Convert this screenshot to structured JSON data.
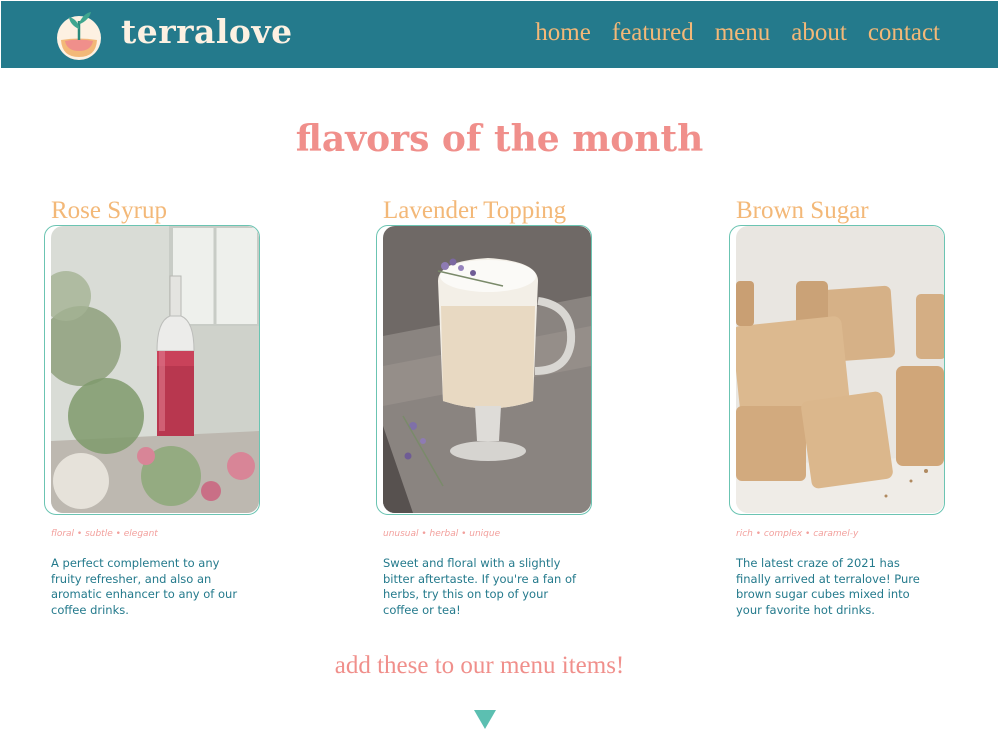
{
  "brand": {
    "name": "terralove",
    "logo_icon": "plant-bowl-icon"
  },
  "nav": [
    {
      "label": "home"
    },
    {
      "label": "featured"
    },
    {
      "label": "menu"
    },
    {
      "label": "about"
    },
    {
      "label": "contact"
    }
  ],
  "page": {
    "title": "flavors of the month"
  },
  "flavors": [
    {
      "name": "Rose Syrup",
      "image": "rose-syrup-bottle-photo",
      "tags": "floral • subtle • elegant",
      "description": "A perfect complement to any fruity refresher, and also an aromatic enhancer to any of our coffee drinks."
    },
    {
      "name": "Lavender Topping",
      "image": "lavender-latte-photo",
      "tags": "unusual • herbal • unique",
      "description": "Sweet and floral with a slightly bitter aftertaste. If you're a fan of herbs, try this on top of your coffee or tea!"
    },
    {
      "name": "Brown Sugar",
      "image": "brown-sugar-cubes-photo",
      "tags": "rich • complex • caramel-y",
      "description": "The latest craze of 2021 has finally arrived at terralove! Pure brown sugar cubes mixed into your favorite hot drinks."
    }
  ],
  "cta": {
    "text": "add these to our menu items!",
    "icon": "down-triangle-icon"
  },
  "colors": {
    "header_bg": "#247a8c",
    "brand_text": "#fdf1e2",
    "nav_text": "#f3b878",
    "title_pink": "#f08f8b",
    "teal_accent": "#6bc4b2"
  }
}
